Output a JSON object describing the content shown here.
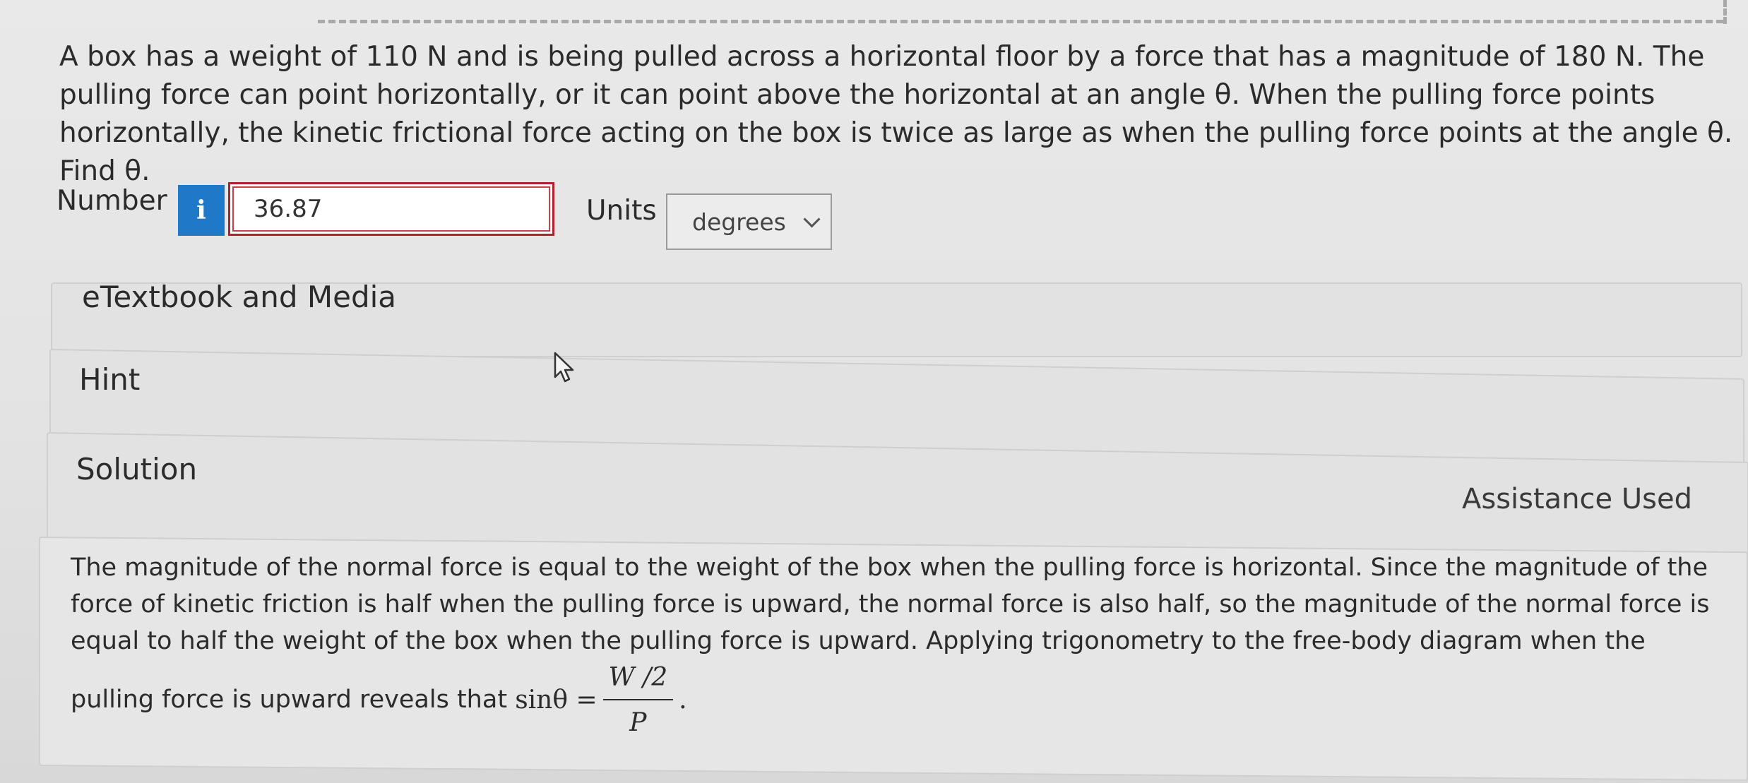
{
  "question": {
    "text": "A box has a weight of 110 N and is being pulled across a horizontal floor by a force that has a magnitude of 180 N. The pulling force can point horizontally, or it can point above the horizontal at an angle θ. When the pulling force points horizontally, the kinetic frictional force acting on the box is twice as large as when the pulling force points at the angle θ. Find θ."
  },
  "answer": {
    "number_label": "Number",
    "info_icon": "i",
    "number_value": "36.87",
    "units_label": "Units",
    "units_selected": "degrees"
  },
  "panels": {
    "etextbook_title": "eTextbook and Media",
    "hint_title": "Hint",
    "solution_title": "Solution",
    "assistance_used": "Assistance Used"
  },
  "solution": {
    "text": "The magnitude of the normal force is equal to the weight of the box when the pulling force is horizontal. Since the magnitude of the force of kinetic friction is half when the pulling force is upward, the normal force is also half, so the magnitude of the normal force is equal to half the weight of the box when the pulling force is upward. Applying trigonometry to the free-body diagram when the pulling force is upward reveals that",
    "formula_lhs": "sinθ =",
    "formula_num": "W /2",
    "formula_den": "P",
    "formula_end": "."
  },
  "colors": {
    "info_button": "#1f78c8",
    "input_border_error": "#b1222f"
  },
  "icons": {
    "info": "info-icon",
    "dropdown": "chevron-down-icon",
    "cursor": "mouse-pointer-icon"
  }
}
